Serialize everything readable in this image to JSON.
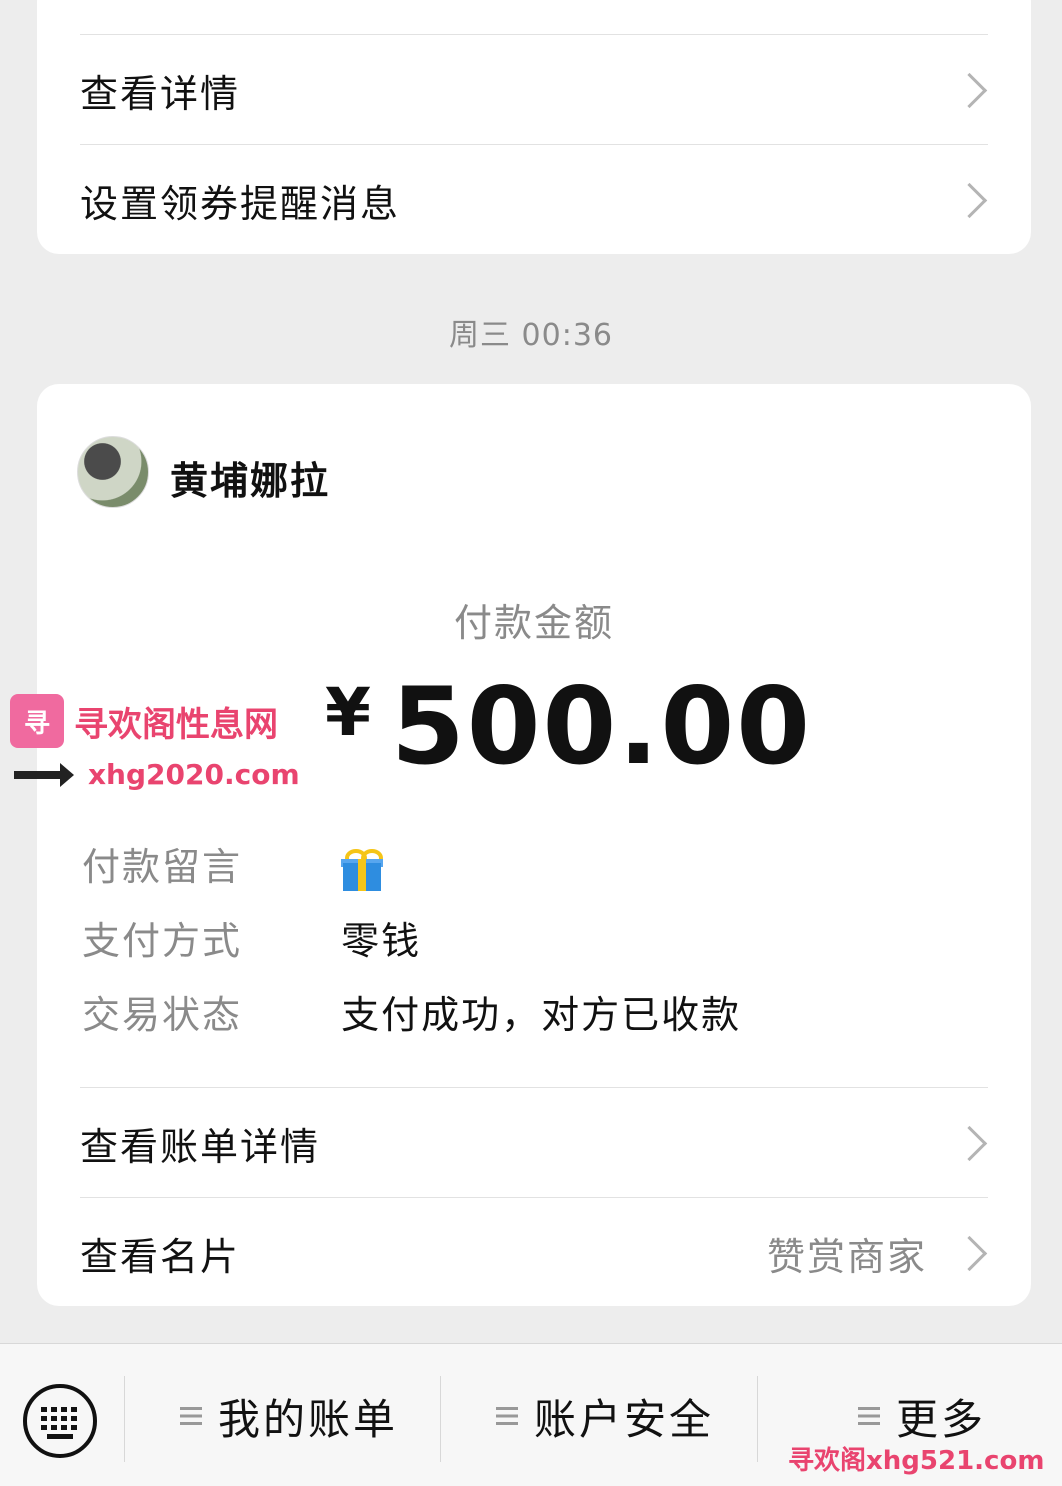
{
  "top_card": {
    "row1": "查看详情",
    "row2": "设置领券提醒消息"
  },
  "timestamp": "周三 00:36",
  "payment": {
    "payee": "黄埔娜拉",
    "amount_label": "付款金额",
    "currency": "¥",
    "amount": "500.00",
    "fields": [
      {
        "key": "付款留言",
        "value": ""
      },
      {
        "key": "支付方式",
        "value": "零钱"
      },
      {
        "key": "交易状态",
        "value": "支付成功，对方已收款"
      }
    ],
    "bill_details": "查看账单详情",
    "card": "查看名片",
    "card_sub": "赞赏商家"
  },
  "bottom_bar": {
    "tabs": [
      "我的账单",
      "账户安全",
      "更多"
    ]
  },
  "watermarks": {
    "logo": "寻",
    "site": "寻欢阁性息网",
    "url1": "xhg2020.com",
    "url2": "寻欢阁xhg521.com"
  }
}
